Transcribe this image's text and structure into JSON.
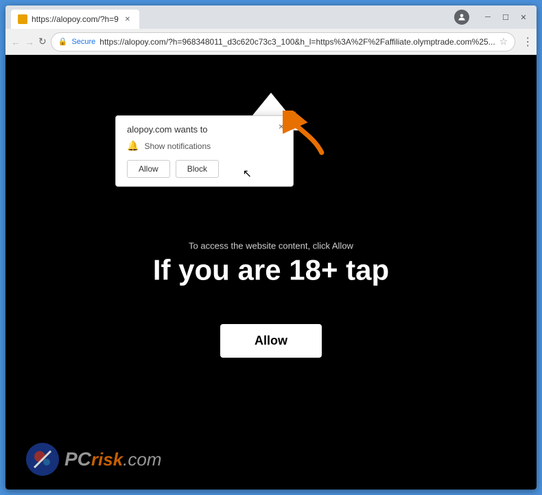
{
  "browser": {
    "tab_label": "https://alopoy.com/?h=9",
    "url_secure_label": "Secure",
    "url_full": "https://alopoy.com/?h=968348011_d3c620c73c3_100&h_l=https%3A%2F%2Faffiliate.olymptrade.com%25...",
    "profile_initial": "👤"
  },
  "nav": {
    "back_icon": "←",
    "forward_icon": "→",
    "reload_icon": "↻"
  },
  "popup": {
    "title": "alopoy.com wants to",
    "notification_label": "Show notifications",
    "allow_label": "Allow",
    "block_label": "Block",
    "close_label": "×"
  },
  "page": {
    "small_text": "To access the website content, click Allow",
    "big_text": "If you are 18+ tap",
    "allow_button_label": "Allow"
  },
  "watermark": {
    "pc_text": "PC",
    "risk_text": "risk",
    "dot_text": ".com"
  }
}
